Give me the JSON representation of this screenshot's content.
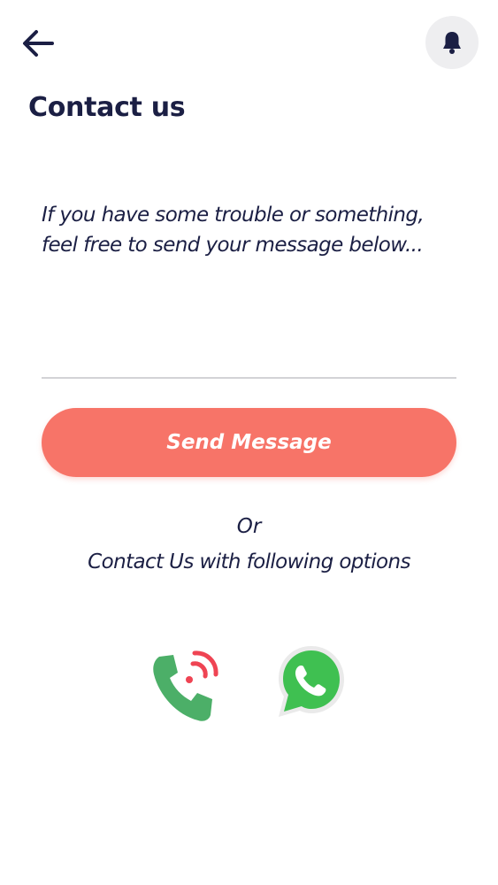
{
  "header": {
    "back_icon": "arrow-left-icon",
    "notification_icon": "bell-icon"
  },
  "page": {
    "title": "Contact us"
  },
  "message": {
    "placeholder": "If you have some trouble or something, feel free to send your message below...",
    "value": ""
  },
  "send_button": {
    "label": "Send Message"
  },
  "alternative": {
    "or_label": "Or",
    "options_label": "Contact Us with following options"
  },
  "contact_options": [
    {
      "icon": "phone-call-icon"
    },
    {
      "icon": "whatsapp-icon"
    }
  ],
  "colors": {
    "primary_text": "#1b1f44",
    "accent": "#f77468",
    "phone_green": "#4caf68",
    "whatsapp_green": "#3fc051",
    "signal_red": "#ef4453"
  }
}
